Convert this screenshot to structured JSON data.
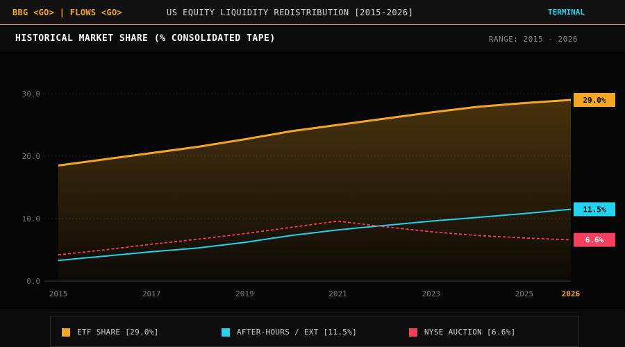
{
  "topbar": {
    "command": "BBG <GO> | FLOWS <GO>",
    "title": "US EQUITY LIQUIDITY REDISTRIBUTION [2015-2026]",
    "terminal_label": "TERMINAL"
  },
  "panel": {
    "title": "HISTORICAL MARKET SHARE (% CONSOLIDATED TAPE)",
    "range_label": "RANGE: 2015 - 2026"
  },
  "legend": {
    "items": [
      {
        "label": "ETF SHARE [29.0%]",
        "color": "#f5a623"
      },
      {
        "label": "AFTER-HOURS / EXT [11.5%]",
        "color": "#22d3ee"
      },
      {
        "label": "NYSE AUCTION [6.6%]",
        "color": "#f43f5e"
      }
    ]
  },
  "chart_data": {
    "type": "line",
    "x": [
      2015,
      2016,
      2017,
      2018,
      2019,
      2020,
      2021,
      2022,
      2023,
      2024,
      2025,
      2026
    ],
    "x_tick_labels": [
      "2015",
      "2017",
      "2019",
      "2021",
      "2023",
      "2025",
      "2026"
    ],
    "y_tick_labels": [
      "0.0",
      "10.0",
      "20.0",
      "30.0"
    ],
    "ylim": [
      0,
      30
    ],
    "grid": true,
    "series": [
      {
        "name": "ETF SHARE",
        "color": "#f5a623",
        "style": "solid-area",
        "values": [
          18.5,
          19.5,
          20.5,
          21.5,
          22.7,
          24.0,
          25.0,
          26.0,
          27.0,
          27.9,
          28.5,
          29.0
        ],
        "end_label": "29.0%"
      },
      {
        "name": "AFTER-HOURS / EXT",
        "color": "#22d3ee",
        "style": "solid",
        "values": [
          3.3,
          4.0,
          4.7,
          5.3,
          6.2,
          7.3,
          8.2,
          8.9,
          9.6,
          10.2,
          10.8,
          11.5
        ],
        "end_label": "11.5%"
      },
      {
        "name": "NYSE AUCTION",
        "color": "#f43f5e",
        "style": "dashed",
        "values": [
          4.2,
          5.0,
          5.9,
          6.7,
          7.6,
          8.6,
          9.6,
          8.7,
          7.9,
          7.3,
          6.9,
          6.6
        ],
        "end_label": "6.6%"
      }
    ]
  }
}
